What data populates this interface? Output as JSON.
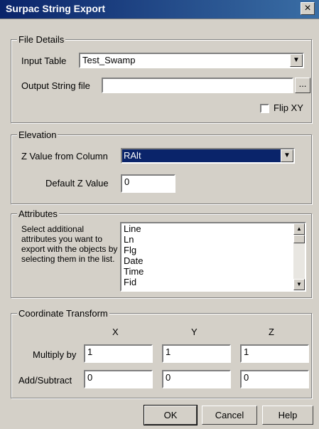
{
  "window": {
    "title": "Surpac String Export",
    "close_glyph": "×"
  },
  "file_details": {
    "title": "File Details",
    "input_table_label": "Input Table",
    "input_table_value": "Test_Swamp",
    "output_file_label": "Output String file",
    "output_file_value": "",
    "browse_label": "...",
    "flip_label": "Flip XY"
  },
  "elevation": {
    "title": "Elevation",
    "z_column_label": "Z Value from Column",
    "z_column_value": "RAlt",
    "default_z_label": "Default Z Value",
    "default_z_value": "0"
  },
  "attributes": {
    "title": "Attributes",
    "description": "Select additional attributes you want to export with the objects by selecting them in the list.",
    "items": [
      "Line",
      "Ln",
      "Flg",
      "Date",
      "Time",
      "Fid"
    ]
  },
  "transform": {
    "title": "Coordinate Transform",
    "col_x": "X",
    "col_y": "Y",
    "col_z": "Z",
    "multiply_label": "Multiply by",
    "multiply": [
      "1",
      "1",
      "1"
    ],
    "add_label": "Add/Subtract",
    "add": [
      "0",
      "0",
      "0"
    ]
  },
  "buttons": {
    "ok": "OK",
    "cancel": "Cancel",
    "help": "Help"
  }
}
